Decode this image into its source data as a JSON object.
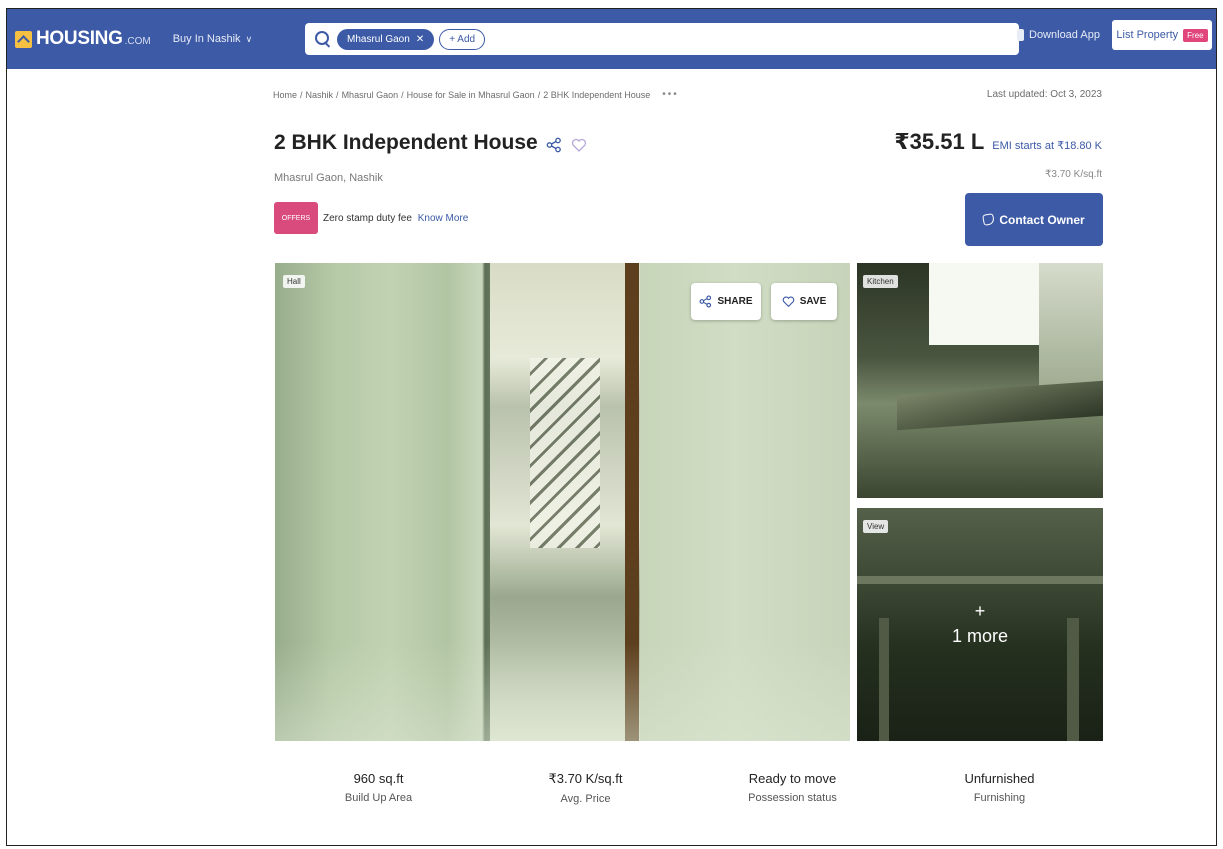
{
  "header": {
    "logo_text": "HOUSING",
    "logo_domain": ".COM",
    "city_selector": "Buy In Nashik",
    "search_chip": "Mhasrul Gaon",
    "add_chip": "+ Add",
    "download_app": "Download App",
    "list_property": "List Property",
    "free_badge": "Free",
    "brand_color": "#3c5aa6"
  },
  "breadcrumb": {
    "items": [
      "Home",
      "Nashik",
      "Mhasrul Gaon",
      "House for Sale in Mhasrul Gaon",
      "2 BHK Independent House"
    ],
    "separator": "/",
    "more": "•••"
  },
  "last_updated": "Last updated: Oct 3, 2023",
  "listing": {
    "title": "2 BHK Independent House",
    "locality": "Mhasrul Gaon, Nashik",
    "offer_badge": "OFFERS",
    "offer_text": "Zero stamp duty fee",
    "offer_link": "Know More",
    "price": "₹35.51 L",
    "emi": "EMI starts at ₹18.80 K",
    "price_per_sqft": "₹3.70 K/sq.ft",
    "contact_button": "Contact Owner"
  },
  "gallery": {
    "main_tag": "Hall",
    "share_label": "SHARE",
    "save_label": "SAVE",
    "kitchen_tag": "Kitchen",
    "view_tag": "View",
    "more_plus": "+",
    "more_text": "1 more"
  },
  "stats": [
    {
      "value": "960 sq.ft",
      "label": "Build Up Area"
    },
    {
      "value": "₹3.70 K/sq.ft",
      "label": "Avg. Price"
    },
    {
      "value": "Ready to move",
      "label": "Possession status"
    },
    {
      "value": "Unfurnished",
      "label": "Furnishing"
    }
  ]
}
